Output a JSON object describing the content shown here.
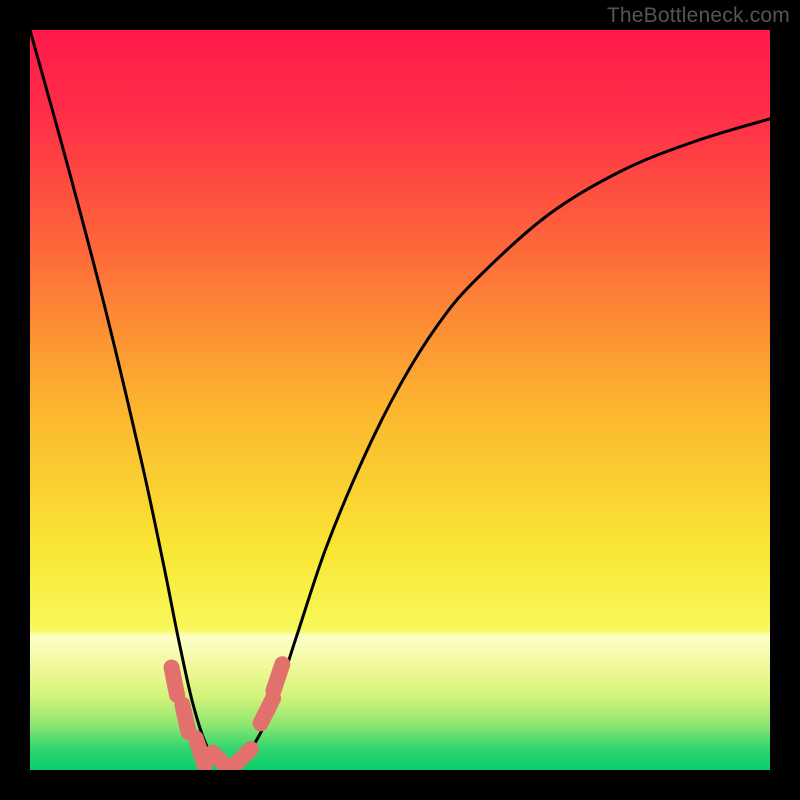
{
  "watermark": "TheBottleneck.com",
  "chart_data": {
    "type": "line",
    "title": "",
    "xlabel": "",
    "ylabel": "",
    "xlim": [
      0,
      100
    ],
    "ylim": [
      0,
      100
    ],
    "series": [
      {
        "name": "bottleneck-curve",
        "x": [
          0,
          5,
          10,
          15,
          18,
          20,
          22,
          24,
          26,
          28,
          30,
          33,
          36,
          40,
          45,
          50,
          55,
          60,
          70,
          80,
          90,
          100
        ],
        "y": [
          100,
          82,
          63,
          42,
          28,
          18,
          9,
          3,
          1,
          1,
          3,
          9,
          18,
          30,
          42,
          52,
          60,
          66,
          75,
          81,
          85,
          88
        ]
      }
    ],
    "markers": [
      {
        "name": "dot-left-upper",
        "x": 19.5,
        "y": 12.0
      },
      {
        "name": "dot-left-mid",
        "x": 21.0,
        "y": 7.0
      },
      {
        "name": "dot-bottom-1",
        "x": 23.0,
        "y": 2.5
      },
      {
        "name": "dot-bottom-2",
        "x": 26.0,
        "y": 1.0
      },
      {
        "name": "dot-bottom-3",
        "x": 28.5,
        "y": 1.5
      },
      {
        "name": "dot-right-mid",
        "x": 32.0,
        "y": 8.0
      },
      {
        "name": "dot-right-upper",
        "x": 33.5,
        "y": 12.5
      }
    ],
    "green_band": {
      "y_start": 0,
      "y_end": 4.5
    },
    "yellow_band": {
      "y_start": 4.5,
      "y_end": 18
    }
  },
  "colors": {
    "marker": "#e2716d",
    "curve": "#000000",
    "frame_bg_stops": [
      {
        "pct": 0,
        "color": "#ff1a4b"
      },
      {
        "pct": 12,
        "color": "#ff2f47"
      },
      {
        "pct": 30,
        "color": "#fd6a3a"
      },
      {
        "pct": 50,
        "color": "#fcb22f"
      },
      {
        "pct": 70,
        "color": "#f9e634"
      },
      {
        "pct": 81,
        "color": "#f8f85a"
      },
      {
        "pct": 82,
        "color": "#fdfecb"
      },
      {
        "pct": 86,
        "color": "#f1f99a"
      },
      {
        "pct": 90,
        "color": "#d4f47a"
      },
      {
        "pct": 94,
        "color": "#8be670"
      },
      {
        "pct": 97,
        "color": "#34d66e"
      },
      {
        "pct": 100,
        "color": "#07cf6b"
      }
    ]
  }
}
